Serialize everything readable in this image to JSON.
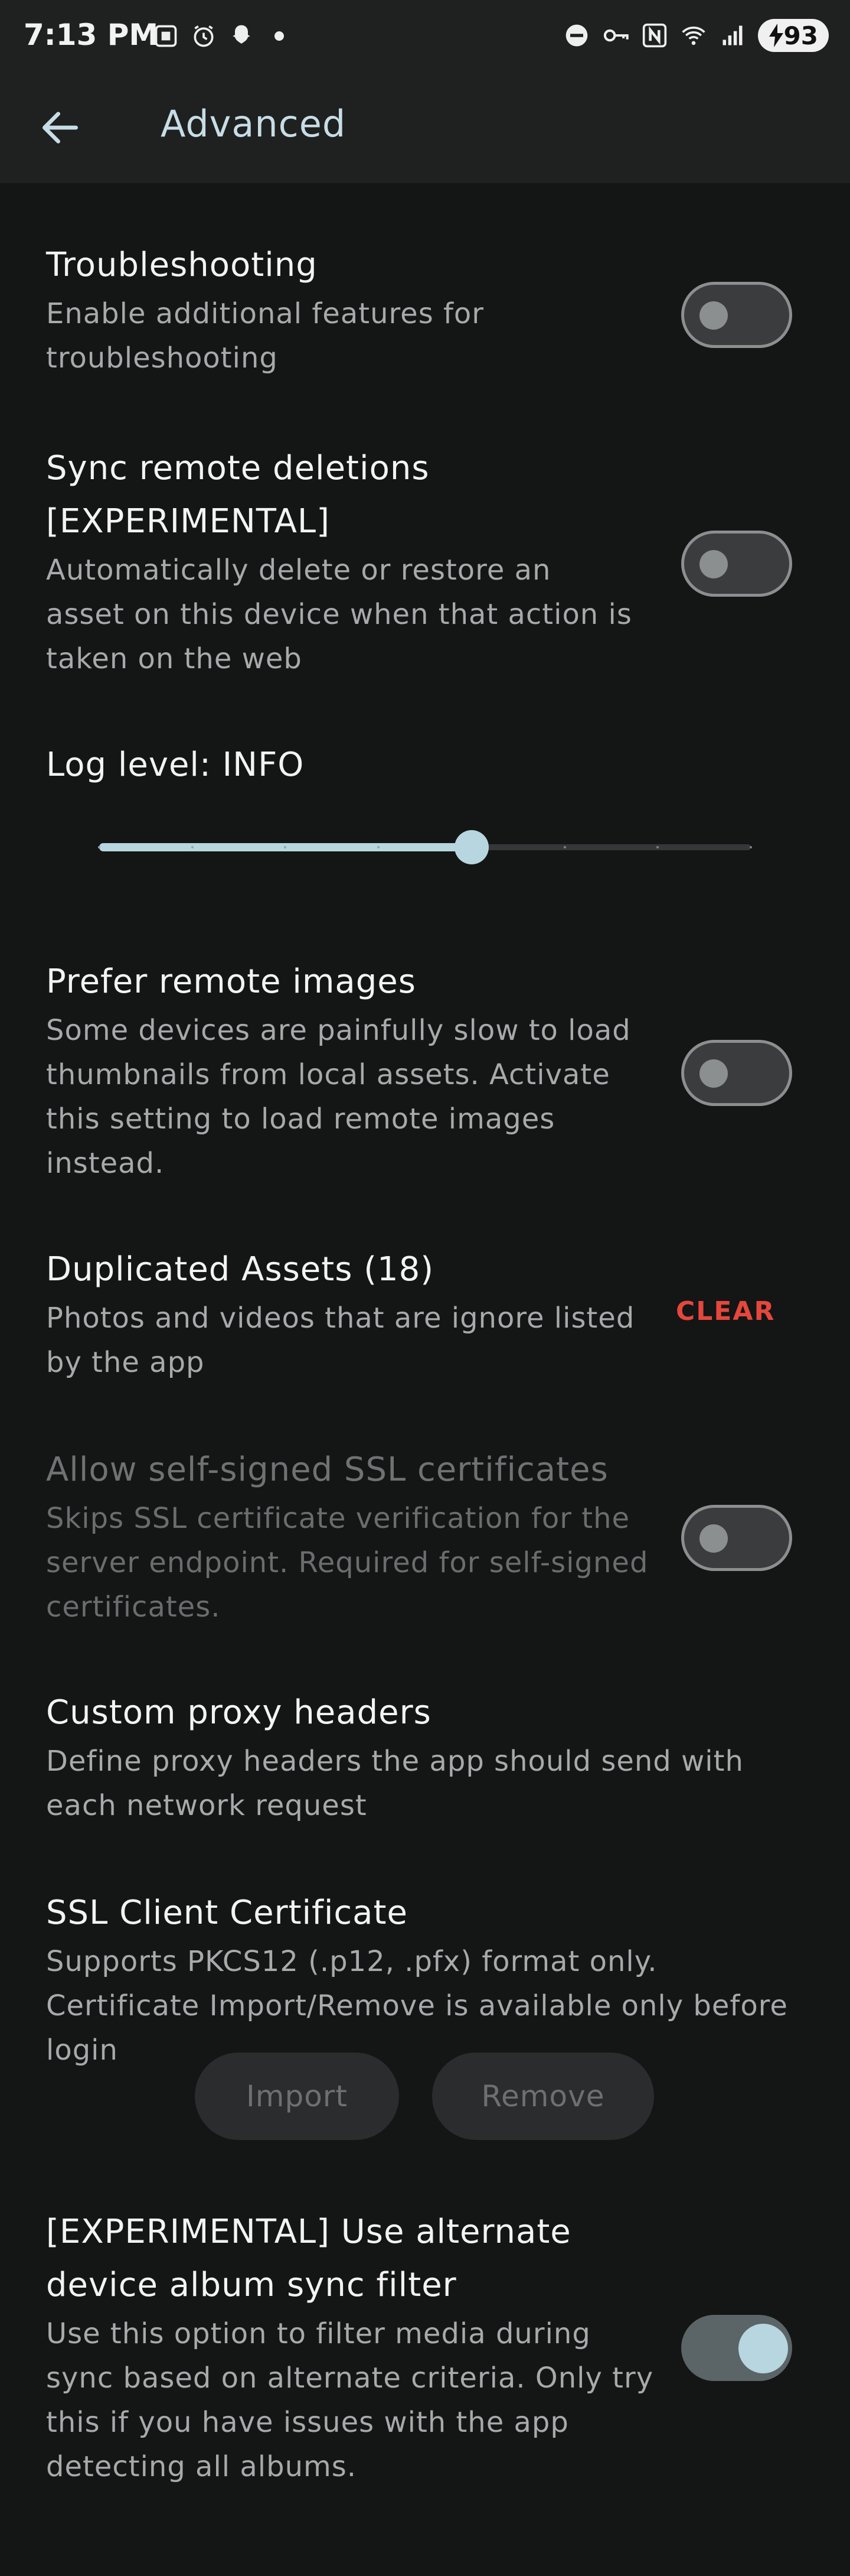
{
  "status_bar": {
    "time": "7:13 PM",
    "battery": "93",
    "left_icons": [
      "screenshot-icon",
      "alarm-icon",
      "snapchat-icon",
      "dot-icon"
    ],
    "right_icons": [
      "dnd-icon",
      "vpn-key-icon",
      "nfc-icon",
      "wifi-icon",
      "signal-icon"
    ]
  },
  "app_bar": {
    "title": "Advanced",
    "back_icon": "arrow-left-icon"
  },
  "settings": {
    "troubleshooting": {
      "title": "Troubleshooting",
      "desc": "Enable additional features for troubleshooting",
      "enabled": false
    },
    "sync_remote_deletions": {
      "title": "Sync remote deletions [EXPERIMENTAL]",
      "desc": "Automatically delete or restore an asset on this device when that action is taken on the web",
      "enabled": false
    },
    "log_level": {
      "title": "Log level: INFO",
      "steps": 8,
      "value_index": 4
    },
    "prefer_remote_images": {
      "title": "Prefer remote images",
      "desc": "Some devices are painfully slow to load thumbnails from local assets. Activate this setting to load remote images instead.",
      "enabled": false
    },
    "duplicated_assets": {
      "title": "Duplicated Assets (18)",
      "desc": "Photos and videos that are ignore listed by the app",
      "action": "CLEAR"
    },
    "self_signed_ssl": {
      "title": "Allow self-signed SSL certificates",
      "desc": "Skips SSL certificate verification for the server endpoint. Required for self-signed certificates.",
      "enabled": false,
      "disabled": true
    },
    "custom_proxy_headers": {
      "title": "Custom proxy headers",
      "desc": "Define proxy headers the app should send with each network request"
    },
    "ssl_client_certificate": {
      "title": "SSL Client Certificate",
      "desc": "Supports PKCS12 (.p12, .pfx) format only. Certificate Import/Remove is available only before login",
      "import_label": "Import",
      "remove_label": "Remove"
    },
    "alternate_album_sync": {
      "title": "[EXPERIMENTAL] Use alternate device album sync filter",
      "desc": "Use this option to filter media during sync based on alternate criteria. Only try this if you have issues with the app detecting all albums.",
      "enabled": true
    }
  },
  "colors": {
    "background": "#141515",
    "app_bar": "#1f2020",
    "accent": "#b7d6df",
    "danger": "#e5473d"
  }
}
